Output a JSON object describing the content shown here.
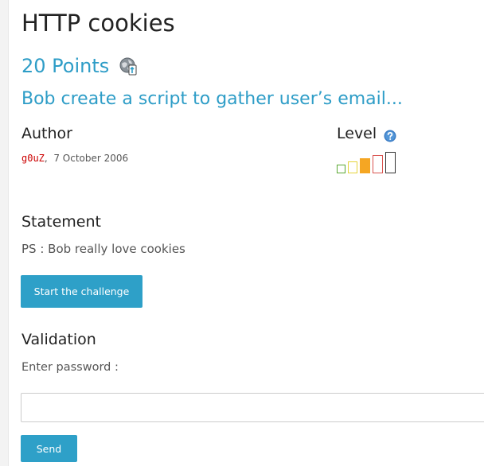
{
  "page": {
    "title": "HTTP cookies",
    "points": "20 Points",
    "subtitle": "Bob create a script to gather user’s email..."
  },
  "author": {
    "heading": "Author",
    "name": "g0uZ",
    "date": "7 October 2006"
  },
  "level": {
    "heading": "Level",
    "current": 3,
    "max": 5,
    "colors": [
      "#5aa832",
      "#e6d43a",
      "#f5a623",
      "#d9534f",
      "#333333"
    ]
  },
  "statement": {
    "heading": "Statement",
    "text": "PS : Bob really love cookies",
    "start_button": "Start the challenge"
  },
  "validation": {
    "heading": "Validation",
    "password_label": "Enter password :",
    "password_value": "",
    "send_button": "Send"
  },
  "icons": {
    "points_icon": "globe-icon",
    "level_help_icon": "help-icon"
  },
  "colors": {
    "accent": "#2e9dc7",
    "button": "#2ea0c8",
    "author": "#cc0000"
  }
}
